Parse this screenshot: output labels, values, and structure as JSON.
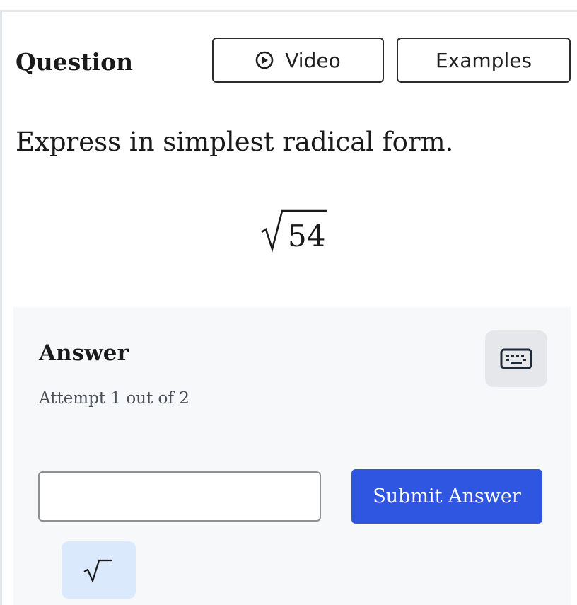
{
  "header": {
    "title": "Question",
    "video_label": "Video",
    "examples_label": "Examples"
  },
  "question": {
    "prompt": "Express in simplest radical form.",
    "radicand": "54"
  },
  "answer": {
    "title": "Answer",
    "attempt_text": "Attempt 1 out of 2",
    "input_value": "",
    "submit_label": "Submit Answer"
  },
  "icons": {
    "video": "play-circle-icon",
    "keyboard": "keyboard-icon",
    "sqrt": "square-root-icon"
  },
  "colors": {
    "submit_bg": "#2f56e0",
    "sqrt_button_bg": "#dbe9fc",
    "keyboard_button_bg": "#e5e7eb",
    "panel_bg": "#f7f8fa"
  }
}
